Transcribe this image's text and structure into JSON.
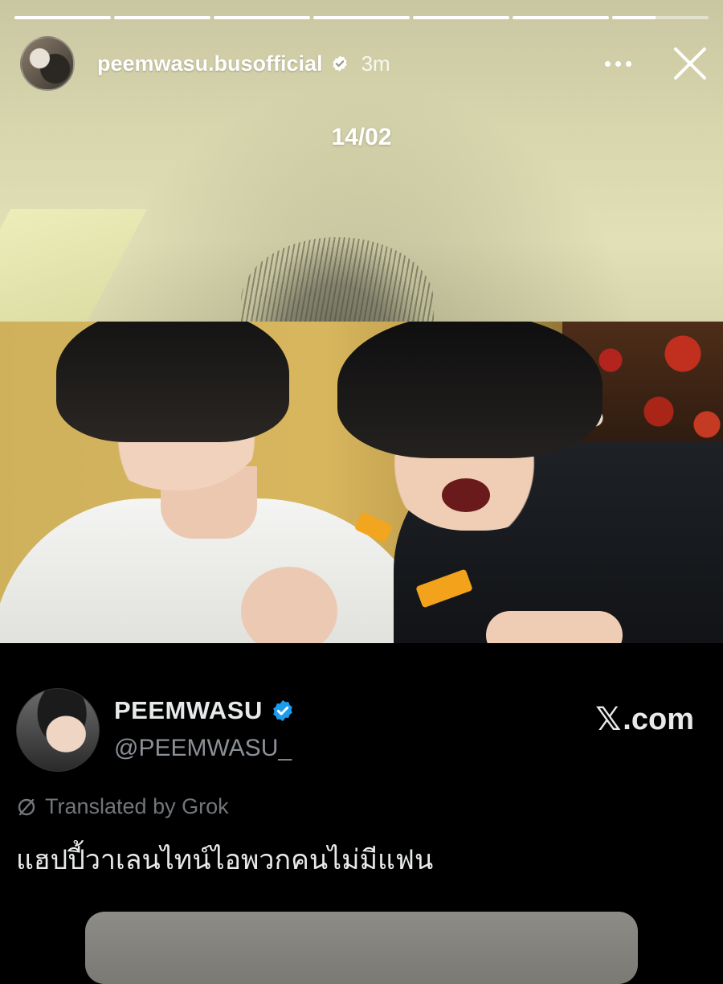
{
  "story": {
    "progress": [
      1,
      1,
      1,
      1,
      1,
      1,
      0.45
    ],
    "username": "peemwasu.busofficial",
    "time": "3m",
    "caption": "14/02",
    "icons": [
      "more-icon",
      "close-icon",
      "verified-badge-icon"
    ]
  },
  "photo": {
    "description_icon": "photo"
  },
  "post": {
    "display_name": "PEEMWASU",
    "handle": "@PEEMWASU_",
    "brand": ".com",
    "brand_mark": "𝕏",
    "translated_label": "Translated by Grok",
    "text": "แฮปปี้วาเลนไทน์ไอพวกคนไม่มีแฟน"
  },
  "colors": {
    "x_verified": "#1d9bf0",
    "background": "#000000",
    "muted_text": "#71767b"
  }
}
